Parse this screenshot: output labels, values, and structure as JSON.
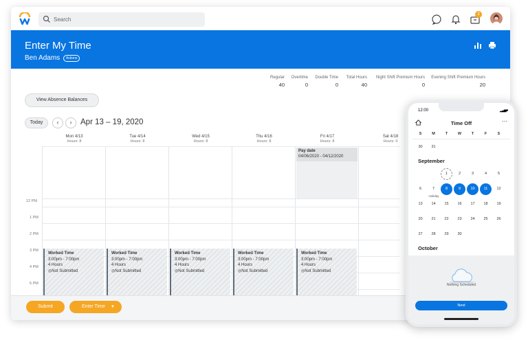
{
  "search": {
    "placeholder": "Search"
  },
  "topbar": {
    "inbox_badge": "3"
  },
  "header": {
    "title": "Enter My Time",
    "user": "Ben Adams",
    "actions": "Actions"
  },
  "summary": [
    {
      "label": "Regular",
      "value": "40"
    },
    {
      "label": "Overtime",
      "value": "0"
    },
    {
      "label": "Double Time",
      "value": "0"
    },
    {
      "label": "Total Hours",
      "value": "40"
    },
    {
      "label": "Night Shift Premium Hours",
      "value": "0"
    },
    {
      "label": "Evening Shift Premium Hours",
      "value": "20"
    }
  ],
  "buttons": {
    "absence": "View Absence Balances",
    "today": "Today",
    "submit": "Submit",
    "enter_time": "Enter Time"
  },
  "range": "Apr 13 – 19, 2020",
  "days": [
    {
      "label": "Mon 4/13",
      "hours": "Hours: 8"
    },
    {
      "label": "Tue 4/14",
      "hours": "Hours: 8"
    },
    {
      "label": "Wed 4/15",
      "hours": "Hours: 8"
    },
    {
      "label": "Thu 4/16",
      "hours": "Hours: 8"
    },
    {
      "label": "Fri 4/17",
      "hours": "Hours: 8"
    },
    {
      "label": "Sat 4/18",
      "hours": "Hours: 0"
    }
  ],
  "hours": [
    "12 PM",
    "1 PM",
    "2 PM",
    "3 PM",
    "4 PM",
    "5 PM"
  ],
  "pay_date": {
    "title": "Pay date",
    "range": "04/06/2020 - 04/12/2020"
  },
  "entries": [
    {
      "title": "Worked Time",
      "time": "3:00pm - 7:00pm",
      "hours": "4 Hours",
      "status": "Not Submitted"
    },
    {
      "title": "Worked Time",
      "time": "3:00pm - 7:00pm",
      "hours": "4 Hours",
      "status": "Not Submitted"
    },
    {
      "title": "Worked Time",
      "time": "3:00pm - 7:00pm",
      "hours": "4 Hours",
      "status": "Not Submitted"
    },
    {
      "title": "Worked Time",
      "time": "3:00pm - 7:00pm",
      "hours": "4 Hours",
      "status": "Not Submitted"
    },
    {
      "title": "Worked Time",
      "time": "3:00pm - 7:00pm",
      "hours": "4 Hours",
      "status": "Not Submitted"
    }
  ],
  "phone": {
    "time": "12:00",
    "title": "Time Off",
    "weekdays": [
      "S",
      "M",
      "T",
      "W",
      "T",
      "F",
      "S"
    ],
    "prev_row": [
      "30",
      "31"
    ],
    "month": "September",
    "rows": [
      [
        "",
        "",
        "1",
        "2",
        "3",
        "4",
        "5"
      ],
      [
        "6",
        "7",
        "8",
        "9",
        "10",
        "11",
        "12"
      ],
      [
        "13",
        "14",
        "15",
        "16",
        "17",
        "18",
        "19"
      ],
      [
        "20",
        "21",
        "22",
        "23",
        "24",
        "25",
        "26"
      ],
      [
        "27",
        "28",
        "29",
        "30",
        "",
        "",
        ""
      ]
    ],
    "holiday_label": "Holiday",
    "next_month": "October",
    "empty": "Nothing Scheduled",
    "next_button": "Next"
  },
  "colors": {
    "brand_blue": "#0875e1",
    "accent_orange": "#f5a623"
  }
}
